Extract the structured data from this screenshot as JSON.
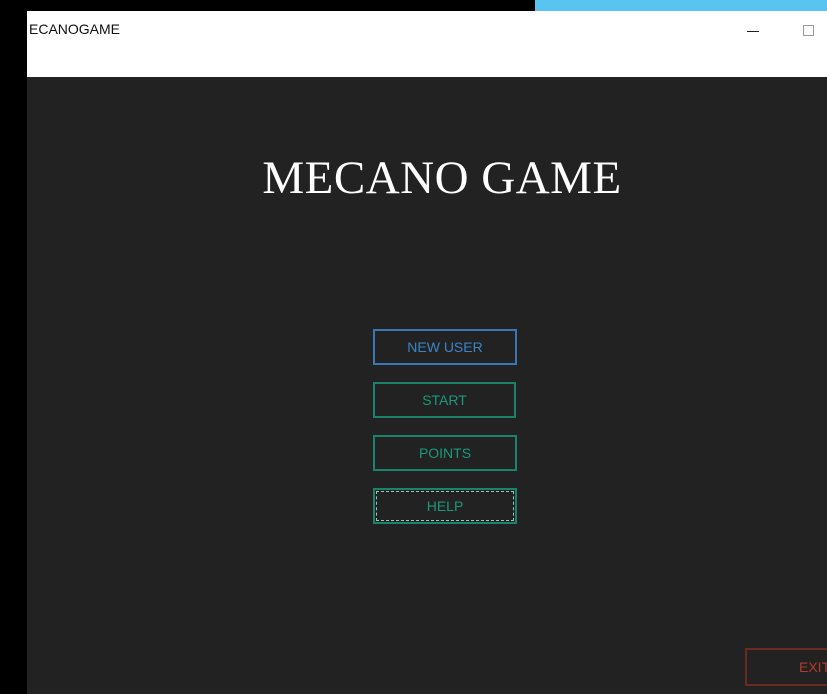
{
  "window": {
    "title": "ECANOGAME",
    "accent_color": "#59c3f2",
    "background_color": "#222222"
  },
  "titlebar": {
    "controls": [
      "minimize-icon",
      "maximize-icon"
    ]
  },
  "main": {
    "game_title": "MECANO GAME",
    "buttons": {
      "new_user": "NEW USER",
      "start": "START",
      "points": "POINTS",
      "help": "HELP",
      "exit": "EXIT"
    },
    "colors": {
      "new_user": "#3c83c6",
      "menu_green": "#1a9a78",
      "exit_red": "#b13b2a"
    }
  }
}
